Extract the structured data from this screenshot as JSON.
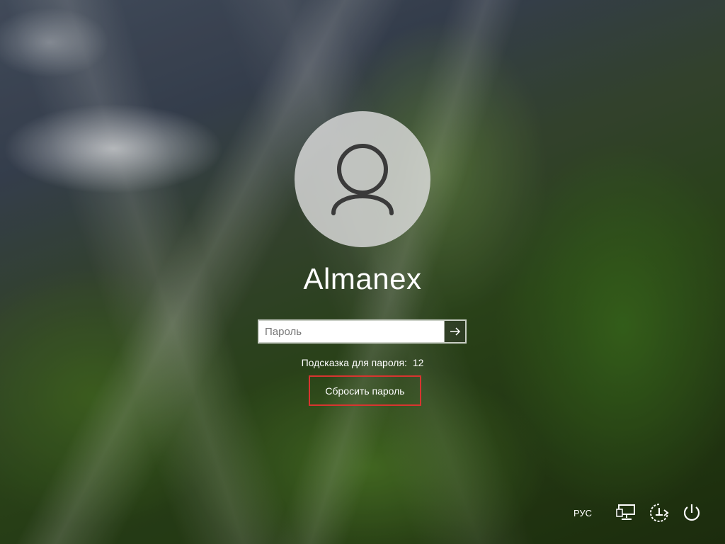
{
  "user": {
    "icon": "user-silhouette-icon",
    "name": "Almanex"
  },
  "password": {
    "placeholder": "Пароль",
    "value": "",
    "submit_icon": "arrow-right-icon"
  },
  "hint": {
    "label": "Подсказка для пароля:",
    "value": "12"
  },
  "reset": {
    "label": "Сбросить пароль",
    "highlight_color": "#d9342f"
  },
  "tray": {
    "language": "РУС",
    "icons": [
      "network-icon",
      "accessibility-icon",
      "power-icon"
    ]
  }
}
